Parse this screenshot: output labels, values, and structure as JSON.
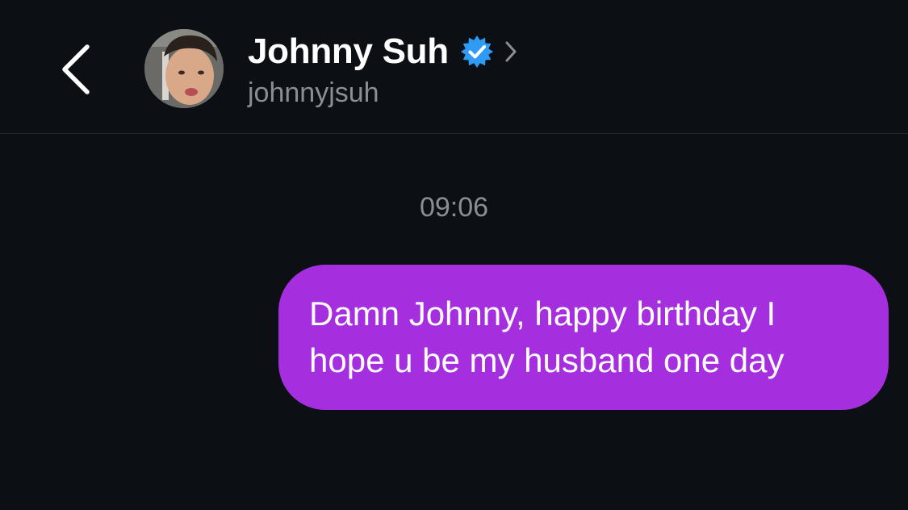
{
  "header": {
    "display_name": "Johnny Suh",
    "username": "johnnyjsuh",
    "verified": true,
    "icons": {
      "back": "chevron-left-icon",
      "verified": "verified-badge-icon",
      "profile": "chevron-right-icon"
    }
  },
  "conversation": {
    "timestamp": "09:06",
    "messages": [
      {
        "sender": "self",
        "lines": [
          "Damn Johnny, happy birthday I",
          "hope u be my husband one day"
        ]
      }
    ]
  },
  "colors": {
    "background": "#0c0f14",
    "sent_bubble": "#a52fde",
    "verified_badge": "#2f9bf5",
    "secondary_text": "#8b8e94"
  }
}
